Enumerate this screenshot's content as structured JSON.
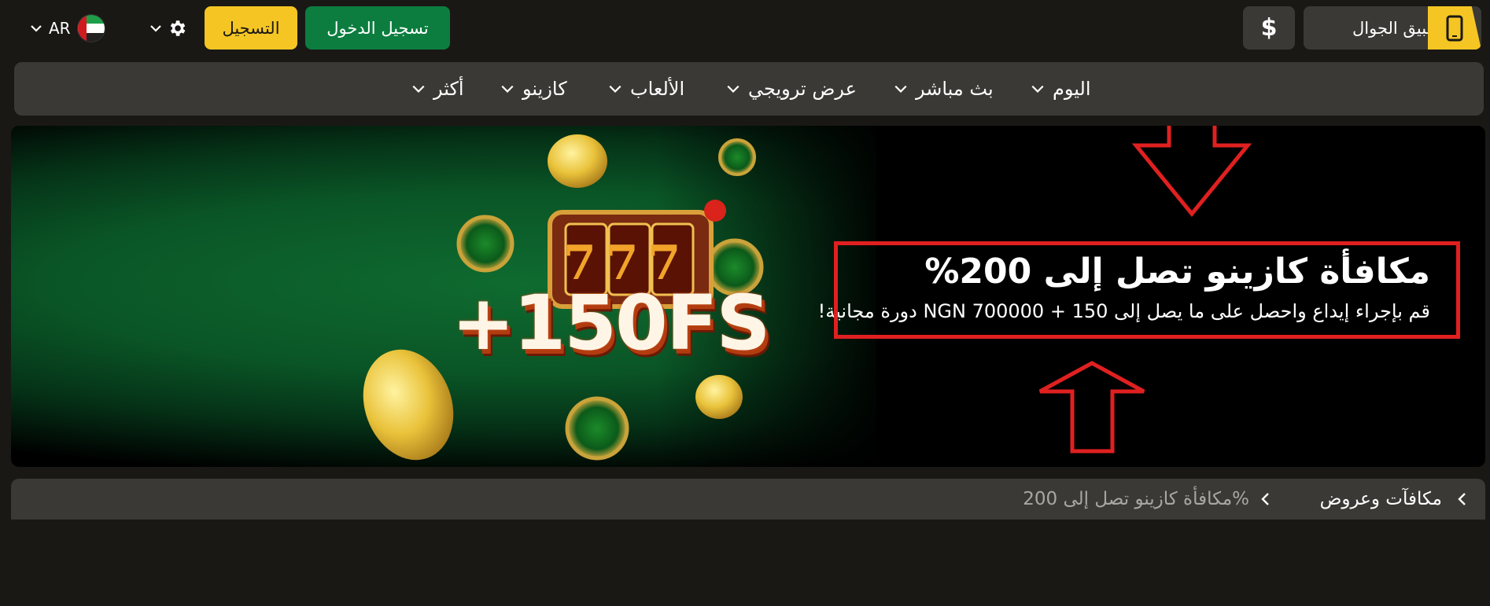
{
  "header": {
    "language_code": "AR",
    "register_label": "التسجيل",
    "login_label": "تسجيل الدخول",
    "currency_symbol": "$",
    "mobile_app_label": "تطبيق الجوال"
  },
  "nav": {
    "items": [
      {
        "label": "اليوم"
      },
      {
        "label": "بث مباشر"
      },
      {
        "label": "عرض ترويجي"
      },
      {
        "label": "الألعاب"
      },
      {
        "label": "كازينو"
      },
      {
        "label": "أكثر"
      }
    ]
  },
  "banner": {
    "title": "مكافأة كازينو تصل إلى 200%",
    "subtitle": "قم بإجراء إيداع واحصل على ما يصل إلى NGN 700000 + 150 دورة مجانية!",
    "art_text": "+150FS",
    "slot_digits": "777"
  },
  "breadcrumb": {
    "items": [
      {
        "label": "مكافآت وعروض"
      },
      {
        "label": "مكافأة كازينو تصل إلى 200%"
      }
    ]
  },
  "colors": {
    "background": "#1a1815",
    "panel": "#3a3936",
    "accent_yellow": "#f5c623",
    "accent_green": "#0c7d3f",
    "annotation_red": "#e02020"
  }
}
